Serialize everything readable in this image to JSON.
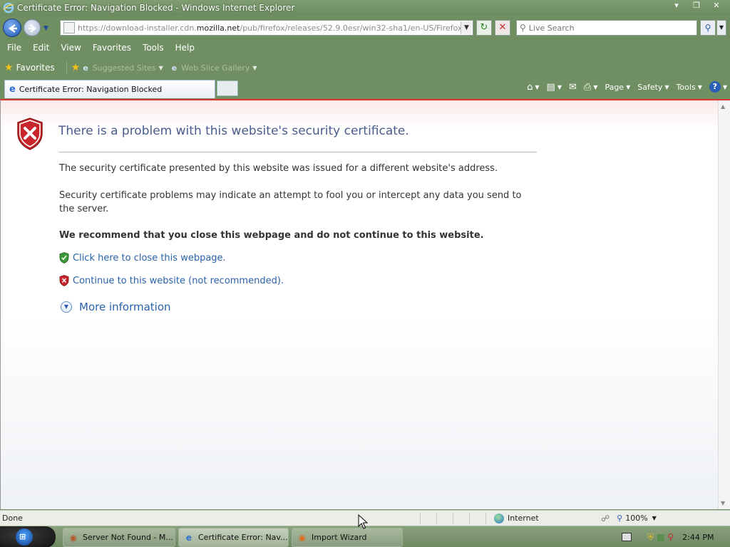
{
  "window": {
    "title": "Certificate Error: Navigation Blocked - Windows Internet Explorer",
    "controls": [
      "minimize",
      "maximize",
      "close"
    ]
  },
  "address_bar": {
    "url_prefix": "https://download-installer.cdn.",
    "url_domain": "mozilla.net",
    "url_suffix": "/pub/firefox/releases/52.9.0esr/win32-sha1/en-US/Firefox%20S"
  },
  "search": {
    "placeholder": "Live Search"
  },
  "menu": [
    "File",
    "Edit",
    "View",
    "Favorites",
    "Tools",
    "Help"
  ],
  "favorites_bar": {
    "favorites_label": "Favorites",
    "items": [
      "Suggested Sites",
      "Web Slice Gallery"
    ]
  },
  "tab": {
    "label": "Certificate Error: Navigation Blocked"
  },
  "command_bar": {
    "page": "Page",
    "safety": "Safety",
    "tools": "Tools"
  },
  "content": {
    "title": "There is a problem with this website's security certificate.",
    "p1": "The security certificate presented by this website was issued for a different website's address.",
    "p2": "Security certificate problems may indicate an attempt to fool you or intercept any data you send to the server.",
    "recommend": "We recommend that you close this webpage and do not continue to this website.",
    "close_link": "Click here to close this webpage.",
    "continue_link": "Continue to this website (not recommended).",
    "more_info": "More information"
  },
  "status_bar": {
    "status": "Done",
    "zone": "Internet",
    "zoom": "100%"
  },
  "taskbar": {
    "items": [
      {
        "label": "Server Not Found - M...",
        "icon": "firefox-icon"
      },
      {
        "label": "Certificate Error: Nav...",
        "icon": "ie-icon"
      },
      {
        "label": "Import Wizard",
        "icon": "firefox-icon"
      }
    ],
    "clock": "2:44 PM"
  },
  "colors": {
    "chrome": "#6f8f63",
    "title_text": "#4a5c8c",
    "link": "#2a62a8",
    "error_red": "#c8262a"
  }
}
